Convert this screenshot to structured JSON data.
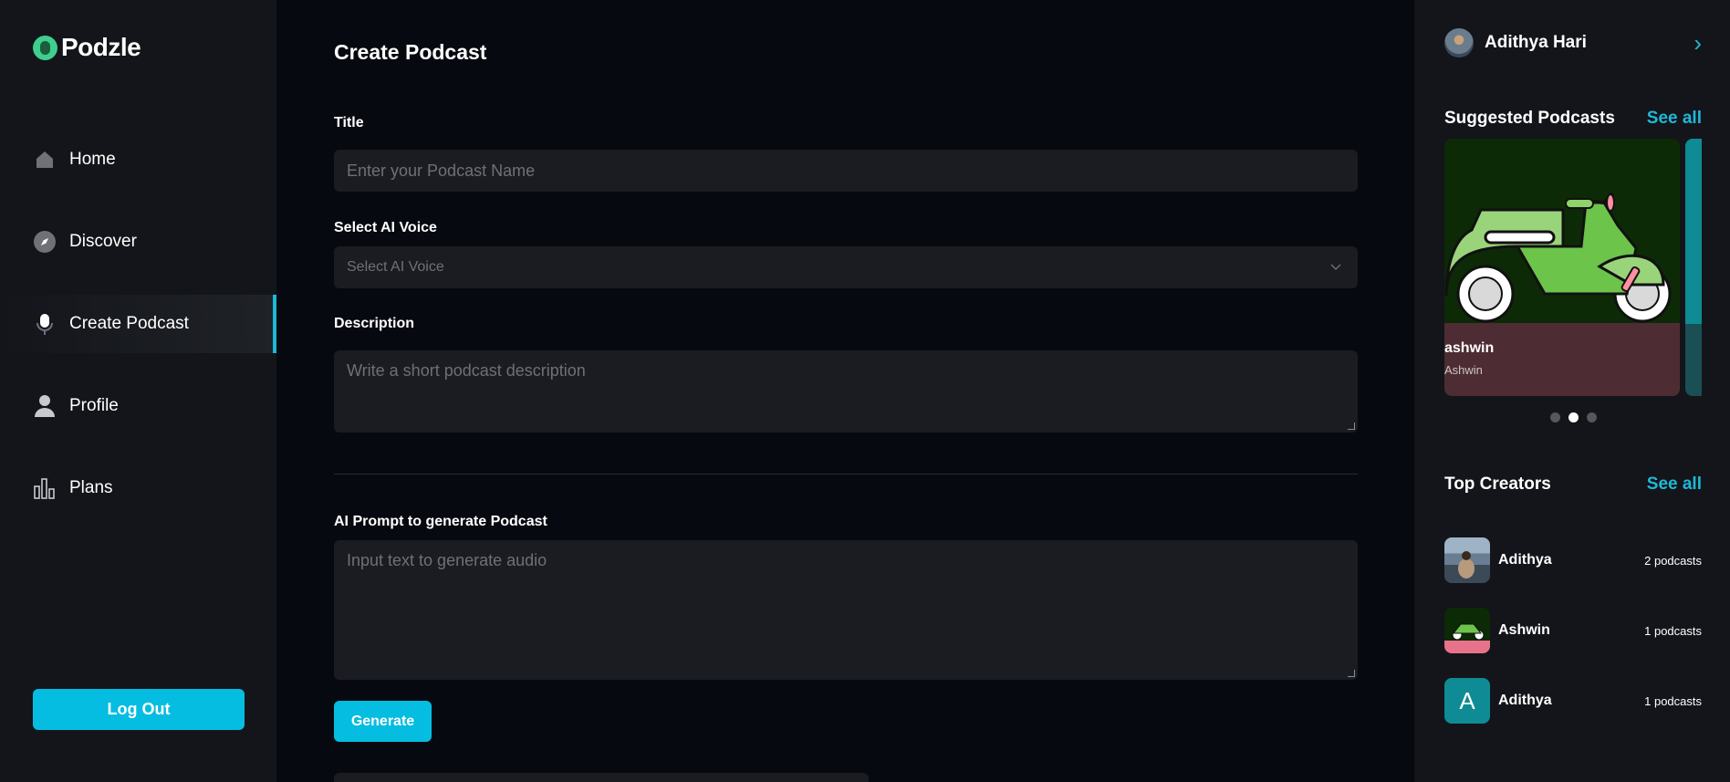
{
  "app": {
    "name": "Podzle",
    "accent": "#05bde0"
  },
  "sidebar": {
    "items": [
      {
        "label": "Home",
        "icon": "home-icon"
      },
      {
        "label": "Discover",
        "icon": "compass-icon"
      },
      {
        "label": "Create Podcast",
        "icon": "microphone-icon",
        "active": true
      },
      {
        "label": "Profile",
        "icon": "user-icon"
      },
      {
        "label": "Plans",
        "icon": "bar-chart-icon"
      }
    ],
    "logout_label": "Log Out"
  },
  "form": {
    "page_title": "Create Podcast",
    "title_label": "Title",
    "title_placeholder": "Enter your Podcast Name",
    "voice_label": "Select AI Voice",
    "voice_value": "Select AI Voice",
    "description_label": "Description",
    "description_placeholder": "Write a short podcast description",
    "prompt_label": "AI Prompt to generate Podcast",
    "prompt_placeholder": "Input text to generate audio",
    "generate_label": "Generate"
  },
  "right": {
    "user_name": "Adithya Hari",
    "suggested_title": "Suggested Podcasts",
    "see_all": "See all",
    "card": {
      "title": "ashwin",
      "author": "Ashwin"
    },
    "carousel": {
      "count": 3,
      "active_index": 1
    },
    "top_creators_title": "Top Creators",
    "creators": [
      {
        "name": "Adithya",
        "count": "2 podcasts",
        "avatar": "photo"
      },
      {
        "name": "Ashwin",
        "count": "1 podcasts",
        "avatar": "scooter"
      },
      {
        "name": "Adithya",
        "count": "1 podcasts",
        "avatar": "letter",
        "letter": "A"
      }
    ]
  }
}
